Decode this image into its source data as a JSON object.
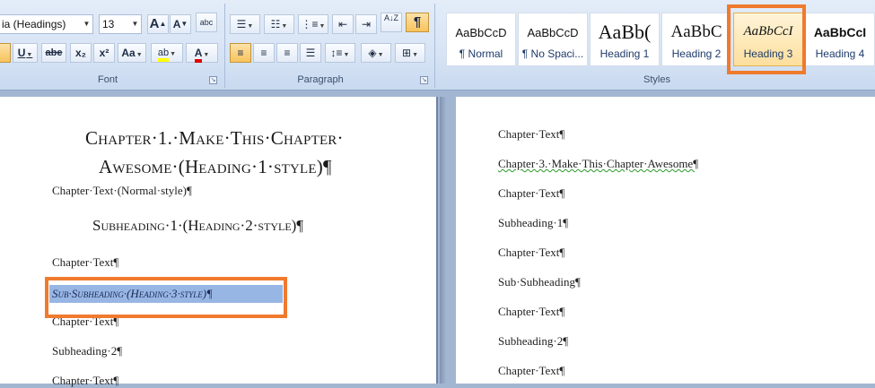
{
  "font_group": {
    "font_name": "ia (Headings)",
    "font_size": "13",
    "grow_font_label": "A",
    "shrink_font_label": "A",
    "clear_format_label": "abc",
    "underline_label": "U",
    "strike_label": "abe",
    "subscript_label": "x₂",
    "superscript_label": "x²",
    "change_case_label": "Aa",
    "highlight_label": "ab",
    "font_color_label": "A",
    "group_label": "Font"
  },
  "paragraph_group": {
    "show_marks_label": "¶",
    "sort_label": "A↓Z",
    "group_label": "Paragraph"
  },
  "styles_group": {
    "group_label": "Styles",
    "tiles": [
      {
        "sample": "AaBbCcD",
        "name": "¶ Normal"
      },
      {
        "sample": "AaBbCcD",
        "name": "¶ No Spaci..."
      },
      {
        "sample": "AaBb(",
        "name": "Heading 1"
      },
      {
        "sample": "AaBbC",
        "name": "Heading 2"
      },
      {
        "sample": "AaBbCcI",
        "name": "Heading 3"
      },
      {
        "sample": "AaBbCcI",
        "name": "Heading 4"
      }
    ]
  },
  "left_page": {
    "h1_line1": "Chapter·1.·Make·This·Chapter·",
    "h1_line2": "Awesome·(Heading·1·style)¶",
    "normal": "Chapter·Text·(Normal·style)¶",
    "h2": "Subheading·1·(Heading·2·style)¶",
    "text1": "Chapter·Text¶",
    "h3_selected": "Sub·Subheading·(Heading·3·style)¶",
    "text2": "Chapter·Text¶",
    "subheading2": "Subheading·2¶",
    "text3": "Chapter·Text¶"
  },
  "right_page": {
    "lines": [
      "Chapter·Text¶",
      "Chapter·3.·Make·This·Chapter·Awesome¶",
      "Chapter·Text¶",
      "Subheading·1¶",
      "Chapter·Text¶",
      "Sub·Subheading¶",
      "Chapter·Text¶",
      "Subheading·2¶",
      "Chapter·Text¶"
    ]
  },
  "colors": {
    "accent_highlight": "#f07a2e",
    "selection": "#98b6e4",
    "ribbon_bg": "#d7e4f5"
  }
}
